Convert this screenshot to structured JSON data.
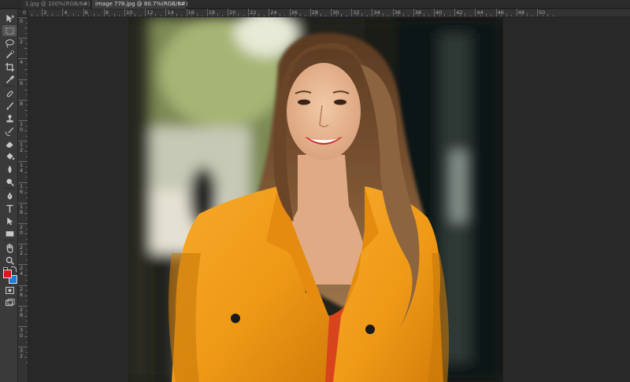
{
  "tabs": [
    {
      "title": "1.jpg @ 100%(RGB/8#)",
      "close": "×",
      "active": false
    },
    {
      "title": "image 778.jpg @ 80.7%(RGB/8#)",
      "close": "×",
      "active": true
    }
  ],
  "ruler": {
    "top_labels": [
      "0",
      "2",
      "4",
      "6",
      "8",
      "10",
      "12",
      "14",
      "16",
      "18",
      "20",
      "22",
      "24",
      "26",
      "28",
      "30",
      "32",
      "34",
      "36",
      "38",
      "40",
      "42",
      "44",
      "46",
      "48",
      "50"
    ],
    "left_labels": [
      "0",
      "2",
      "4",
      "6",
      "8",
      "10",
      "12",
      "14",
      "16",
      "18",
      "20",
      "22",
      "24",
      "26",
      "28",
      "30",
      "32"
    ]
  },
  "tools": [
    {
      "name": "move-tool-icon"
    },
    {
      "name": "rectangular-marquee-icon",
      "selected": true
    },
    {
      "name": "lasso-icon"
    },
    {
      "name": "quick-selection-icon"
    },
    {
      "name": "crop-icon"
    },
    {
      "name": "eyedropper-icon"
    },
    {
      "name": "healing-brush-icon"
    },
    {
      "name": "brush-icon"
    },
    {
      "name": "clone-stamp-icon"
    },
    {
      "name": "history-brush-icon"
    },
    {
      "name": "eraser-icon"
    },
    {
      "name": "paint-bucket-icon"
    },
    {
      "name": "blur-icon"
    },
    {
      "name": "dodge-icon"
    },
    {
      "name": "pen-icon"
    },
    {
      "name": "type-icon"
    },
    {
      "name": "path-selection-icon"
    },
    {
      "name": "rectangle-shape-icon"
    },
    {
      "name": "hand-icon"
    },
    {
      "name": "zoom-icon"
    }
  ],
  "colors": {
    "foreground": "#e0141c",
    "background": "#1a7fe0",
    "app_bg": "#282828",
    "panel_bg": "#3a3a3a"
  },
  "canvas": {
    "image_name": "image 778.jpg",
    "zoom": "80.7%"
  }
}
